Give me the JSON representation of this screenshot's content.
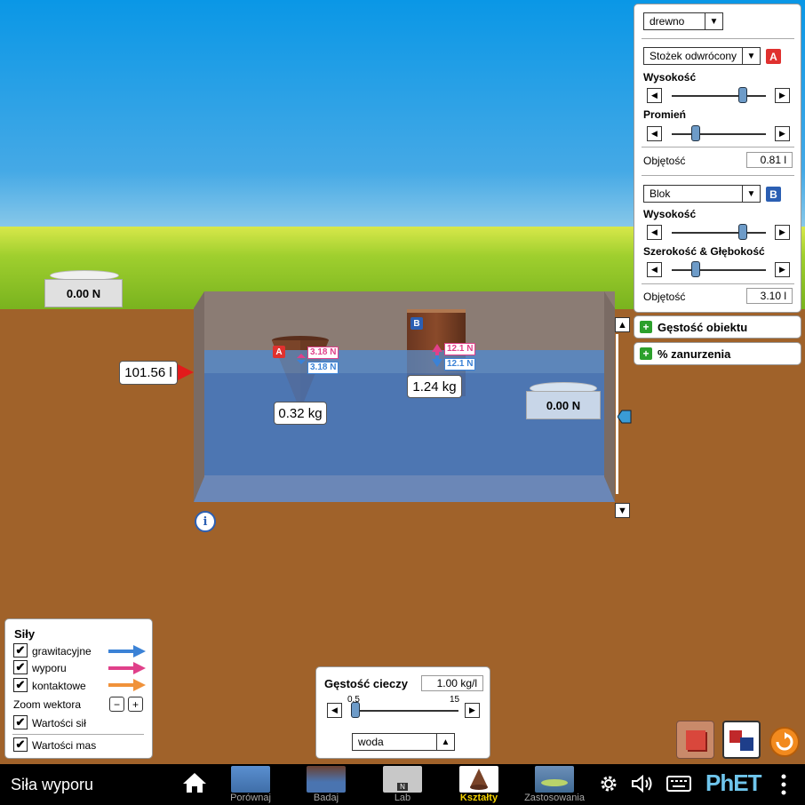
{
  "scene": {
    "left_scale_value": "0.00 N",
    "right_scale_value": "0.00 N",
    "liquid_volume": "101.56 l",
    "object_a": {
      "badge": "A",
      "mass": "0.32 kg",
      "force_top": "3.18 N",
      "force_bottom": "3.18 N"
    },
    "object_b": {
      "badge": "B",
      "mass": "1.24 kg",
      "force_top": "12.1 N",
      "force_bottom": "12.1 N"
    },
    "info_glyph": "i",
    "level_up": "▲",
    "level_down": "▼"
  },
  "right_panel": {
    "material": "drewno",
    "shape_a": {
      "name": "Stożek odwrócony",
      "badge": "A",
      "param1_label": "Wysokość",
      "param1_fraction": 0.75,
      "param2_label": "Promień",
      "param2_fraction": 0.25,
      "volume_label": "Objętość",
      "volume_value": "0.81 l"
    },
    "shape_b": {
      "name": "Blok",
      "badge": "B",
      "param1_label": "Wysokość",
      "param1_fraction": 0.75,
      "param2_label": "Szerokość & Głębokość",
      "param2_fraction": 0.25,
      "volume_label": "Objętość",
      "volume_value": "3.10 l"
    },
    "density_toggle": "Gęstość obiektu",
    "submersion_toggle": "% zanurzenia",
    "combo_arrow": "▼"
  },
  "forces_panel": {
    "title": "Siły",
    "gravity_label": "grawitacyjne",
    "buoyancy_label": "wyporu",
    "contact_label": "kontaktowe",
    "zoom_label": "Zoom wektora",
    "zoom_minus": "−",
    "zoom_plus": "+",
    "force_values_label": "Wartości sił",
    "mass_values_label": "Wartości mas",
    "check": "✔",
    "colors": {
      "gravity": "#3b82d6",
      "buoyancy": "#e0408a",
      "contact": "#f0923a"
    }
  },
  "fluid_panel": {
    "title": "Gęstość cieczy",
    "value": "1.00 kg/l",
    "min_label": "0.5",
    "max_label": "15",
    "slider_fraction": 0.035,
    "fluid_name": "woda",
    "fluid_arrow": "▲"
  },
  "navbar": {
    "title": "Siła wyporu",
    "tabs": [
      {
        "label": "Porównaj"
      },
      {
        "label": "Badaj"
      },
      {
        "label": "Lab"
      },
      {
        "label": "Kształty"
      },
      {
        "label": "Zastosowania"
      }
    ],
    "active_tab": "Kształty",
    "logo": "PhET",
    "scale_glyph": "N"
  }
}
